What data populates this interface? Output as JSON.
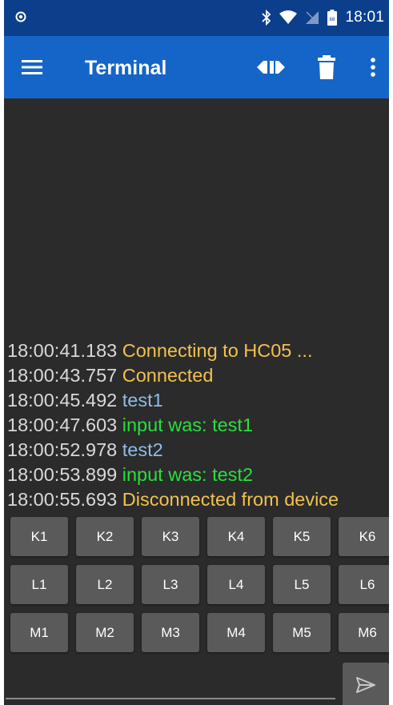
{
  "status_bar": {
    "time": "18:01",
    "battery_level": "68",
    "icons": [
      "notification-dot-icon",
      "bluetooth-icon",
      "wifi-icon",
      "no-sim-icon",
      "battery-icon"
    ]
  },
  "app_bar": {
    "title": "Terminal",
    "actions": [
      "menu-icon",
      "connect-icon",
      "delete-icon",
      "overflow-menu-icon"
    ],
    "colors": {
      "status_bar": "#0b3f8c",
      "app_bar": "#1565c8"
    }
  },
  "terminal": {
    "colors": {
      "background": "#2b2b2b",
      "timestamp": "#d9d9d9",
      "status": "#f2c14e",
      "sent": "#8fbbe8",
      "received": "#27e03c"
    },
    "lines": [
      {
        "time": "18:00:41.183",
        "text": "Connecting to HC05 ...",
        "kind": "status"
      },
      {
        "time": "18:00:43.757",
        "text": "Connected",
        "kind": "status"
      },
      {
        "time": "18:00:45.492",
        "text": "test1",
        "kind": "sent"
      },
      {
        "time": "18:00:47.603",
        "text": "input was: test1",
        "kind": "recv"
      },
      {
        "time": "18:00:52.978",
        "text": "test2",
        "kind": "sent"
      },
      {
        "time": "18:00:53.899",
        "text": "input was: test2",
        "kind": "recv"
      },
      {
        "time": "18:00:55.693",
        "text": "Disconnected from device",
        "kind": "status"
      }
    ]
  },
  "macro_keys": {
    "rows": [
      [
        "K1",
        "K2",
        "K3",
        "K4",
        "K5",
        "K6"
      ],
      [
        "L1",
        "L2",
        "L3",
        "L4",
        "L5",
        "L6"
      ],
      [
        "M1",
        "M2",
        "M3",
        "M4",
        "M5",
        "M6"
      ]
    ]
  },
  "input": {
    "value": "",
    "placeholder": "",
    "send_icon": "send-icon"
  }
}
